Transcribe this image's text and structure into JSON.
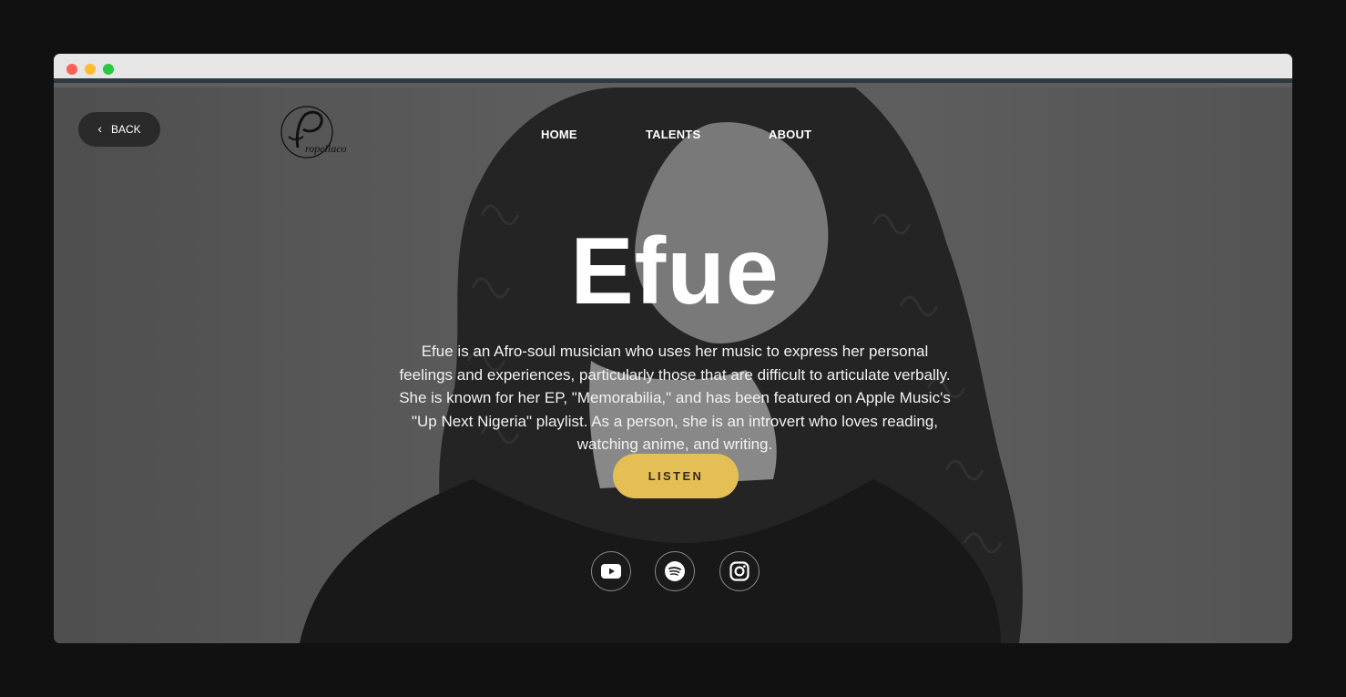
{
  "window": {
    "controls": [
      "close",
      "minimize",
      "maximize"
    ]
  },
  "header": {
    "back_label": "BACK",
    "logo_text": "Propellaco",
    "nav": [
      {
        "label": "HOME"
      },
      {
        "label": "TALENTS"
      },
      {
        "label": "ABOUT"
      }
    ]
  },
  "hero": {
    "name": "Efue",
    "bio": "Efue is an Afro-soul musician who uses her music to express her personal feelings and experiences, particularly those that are difficult to articulate verbally. She is known for her EP, \"Memorabilia,\" and has been featured on Apple Music's \"Up Next Nigeria\" playlist. As a person, she is an introvert who loves reading, watching anime, and writing.",
    "listen_label": "LISTEN",
    "socials": [
      {
        "icon": "youtube-icon"
      },
      {
        "icon": "spotify-icon"
      },
      {
        "icon": "instagram-icon"
      }
    ]
  },
  "colors": {
    "accent": "#e3bf55",
    "page_bg": "#111111",
    "chrome_bar": "#e6e6e6",
    "chrome_border": "#2d3a40"
  }
}
